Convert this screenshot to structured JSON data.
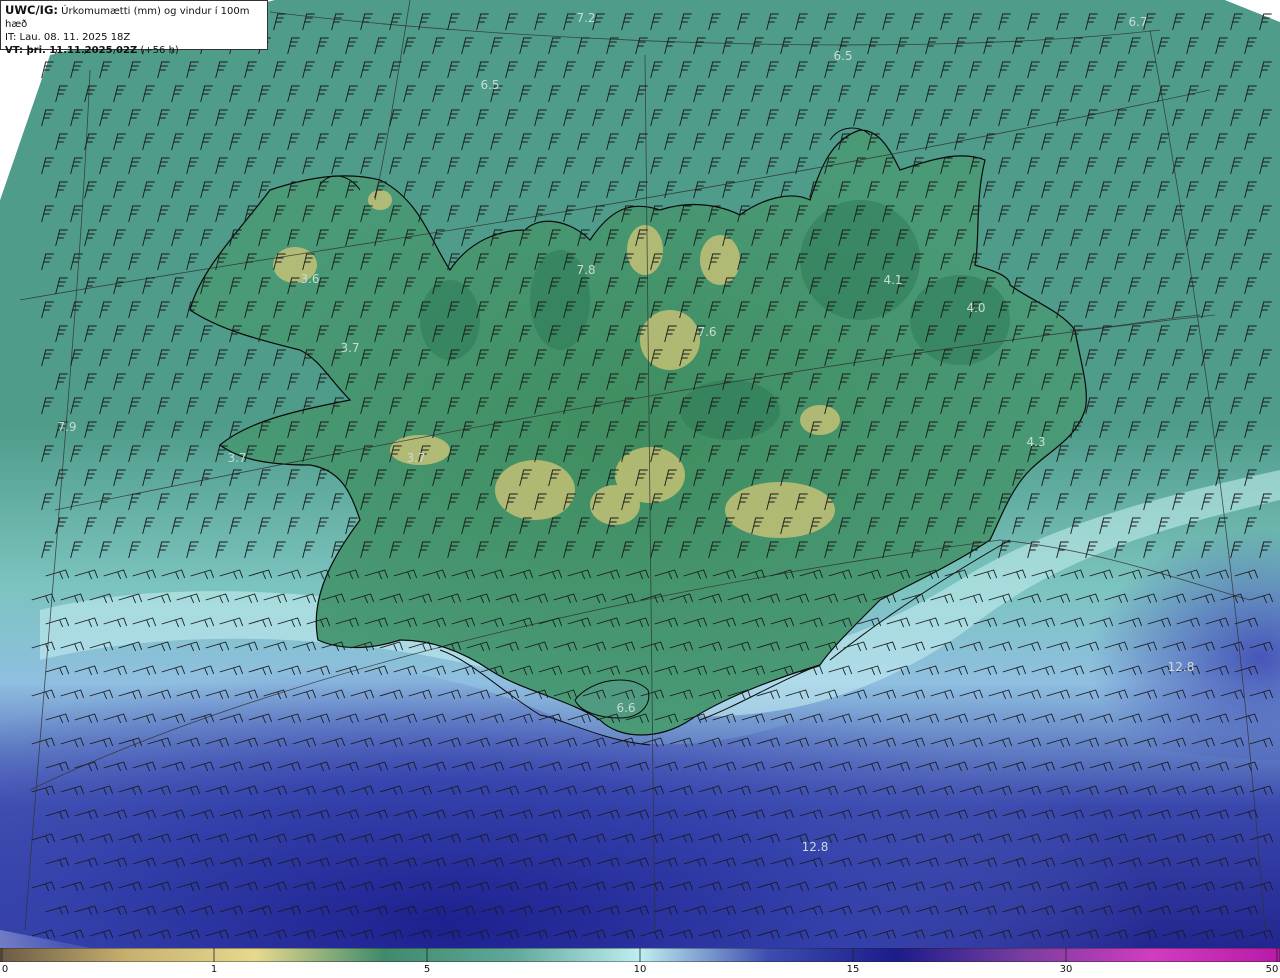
{
  "header": {
    "model": "UWC/IG:",
    "title": "Úrkomumætti (mm) og vindur í 100m hæð",
    "init_time": "IT: Lau. 08. 11. 2025 18Z",
    "valid_prefix": "VT: þri. 11.11.2025 02Z",
    "valid_suffix": "(+56 h)"
  },
  "map_labels": [
    "7.2",
    "6.7",
    "6.5",
    "6.5",
    "3.6",
    "7.8",
    "4.1",
    "4.0",
    "3.7",
    "7.6",
    "7.9",
    "3.7",
    "3.7",
    "4.3",
    "12.8",
    "6.6",
    "12.8"
  ],
  "colorbar": {
    "ticks": [
      "0",
      "1",
      "5",
      "10",
      "15",
      "30",
      "50"
    ],
    "stops": [
      "#6b5a45",
      "#c8b06f",
      "#e6d98d",
      "#3f8a6b",
      "#5fa89a",
      "#bfeef0",
      "#3d4db0",
      "#1b1c8a",
      "#7a3da0",
      "#d13cc0",
      "#b81aa8"
    ]
  },
  "colors": {
    "sea_northwest": "#4d9e88",
    "highland": "#d4c777",
    "sea_south": "#3848b0",
    "coastline": "#0a0a0a"
  }
}
